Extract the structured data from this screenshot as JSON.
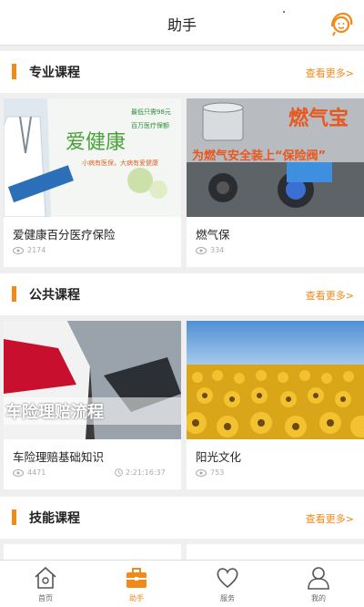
{
  "header": {
    "title": "助手"
  },
  "sections": [
    {
      "title": "专业课程",
      "more": "查看更多>",
      "cards": [
        {
          "title": "爱健康百分医疗保险",
          "views": "2174",
          "img_logo": "爱健康",
          "img_lines": [
            "最低只需98元",
            "百万医疗保额",
            "小病有医保，大病有爱健康"
          ]
        },
        {
          "title": "燃气保",
          "views": "334",
          "img_logo": "燃气宝",
          "img_banner": "为燃气安全装上“保险阀”"
        }
      ]
    },
    {
      "title": "公共课程",
      "more": "查看更多>",
      "cards": [
        {
          "title": "车险理赔基础知识",
          "views": "4471",
          "duration": "2:21:16:37",
          "img_banner": "车险理赔流程"
        },
        {
          "title": "阳光文化",
          "views": "753"
        }
      ]
    },
    {
      "title": "技能课程",
      "more": "查看更多>"
    }
  ],
  "tabs": [
    {
      "label": "首页",
      "icon": "home-icon"
    },
    {
      "label": "助手",
      "icon": "briefcase-icon",
      "active": true
    },
    {
      "label": "服务",
      "icon": "heart-icon"
    },
    {
      "label": "我的",
      "icon": "user-icon"
    }
  ],
  "colors": {
    "accent": "#f08a1a",
    "background": "#f0efef"
  }
}
